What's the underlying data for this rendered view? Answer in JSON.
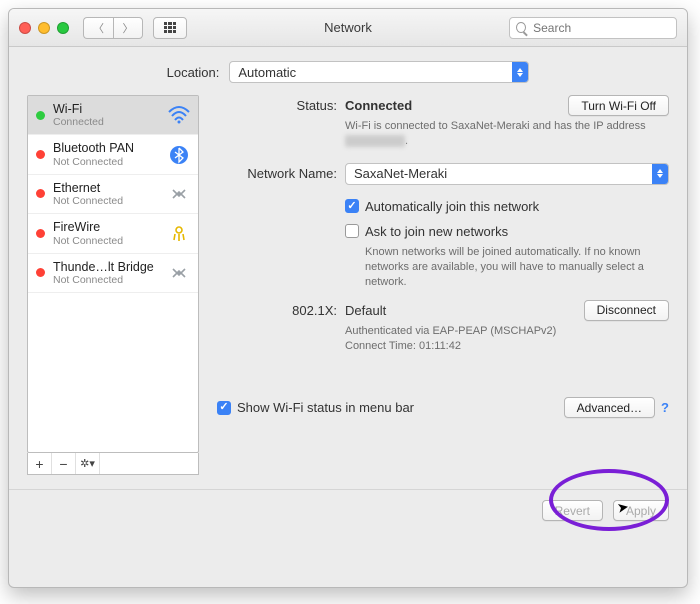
{
  "window": {
    "title": "Network",
    "search_placeholder": "Search"
  },
  "location": {
    "label": "Location:",
    "value": "Automatic"
  },
  "sidebar": {
    "items": [
      {
        "name": "Wi-Fi",
        "sub": "Connected",
        "status": "green",
        "icon": "wifi"
      },
      {
        "name": "Bluetooth PAN",
        "sub": "Not Connected",
        "status": "red",
        "icon": "bluetooth"
      },
      {
        "name": "Ethernet",
        "sub": "Not Connected",
        "status": "red",
        "icon": "ethernet"
      },
      {
        "name": "FireWire",
        "sub": "Not Connected",
        "status": "red",
        "icon": "firewire"
      },
      {
        "name": "Thunde…lt Bridge",
        "sub": "Not Connected",
        "status": "red",
        "icon": "ethernet"
      }
    ]
  },
  "status": {
    "label": "Status:",
    "value": "Connected",
    "toggle": "Turn Wi-Fi Off",
    "desc_a": "Wi-Fi is connected to SaxaNet-Meraki and has the IP address",
    "desc_b": "."
  },
  "network_name": {
    "label": "Network Name:",
    "value": "SaxaNet-Meraki",
    "auto_join": "Automatically join this network",
    "ask_join": "Ask to join new networks",
    "ask_desc": "Known networks will be joined automatically. If no known networks are available, you will have to manually select a network."
  },
  "dot1x": {
    "label": "802.1X:",
    "value": "Default",
    "button": "Disconnect",
    "auth": "Authenticated via EAP-PEAP (MSCHAPv2)",
    "time": "Connect Time: 01:11:42"
  },
  "menubar_cb": "Show Wi-Fi status in menu bar",
  "advanced": "Advanced…",
  "footer": {
    "revert": "Revert",
    "apply": "Apply"
  }
}
